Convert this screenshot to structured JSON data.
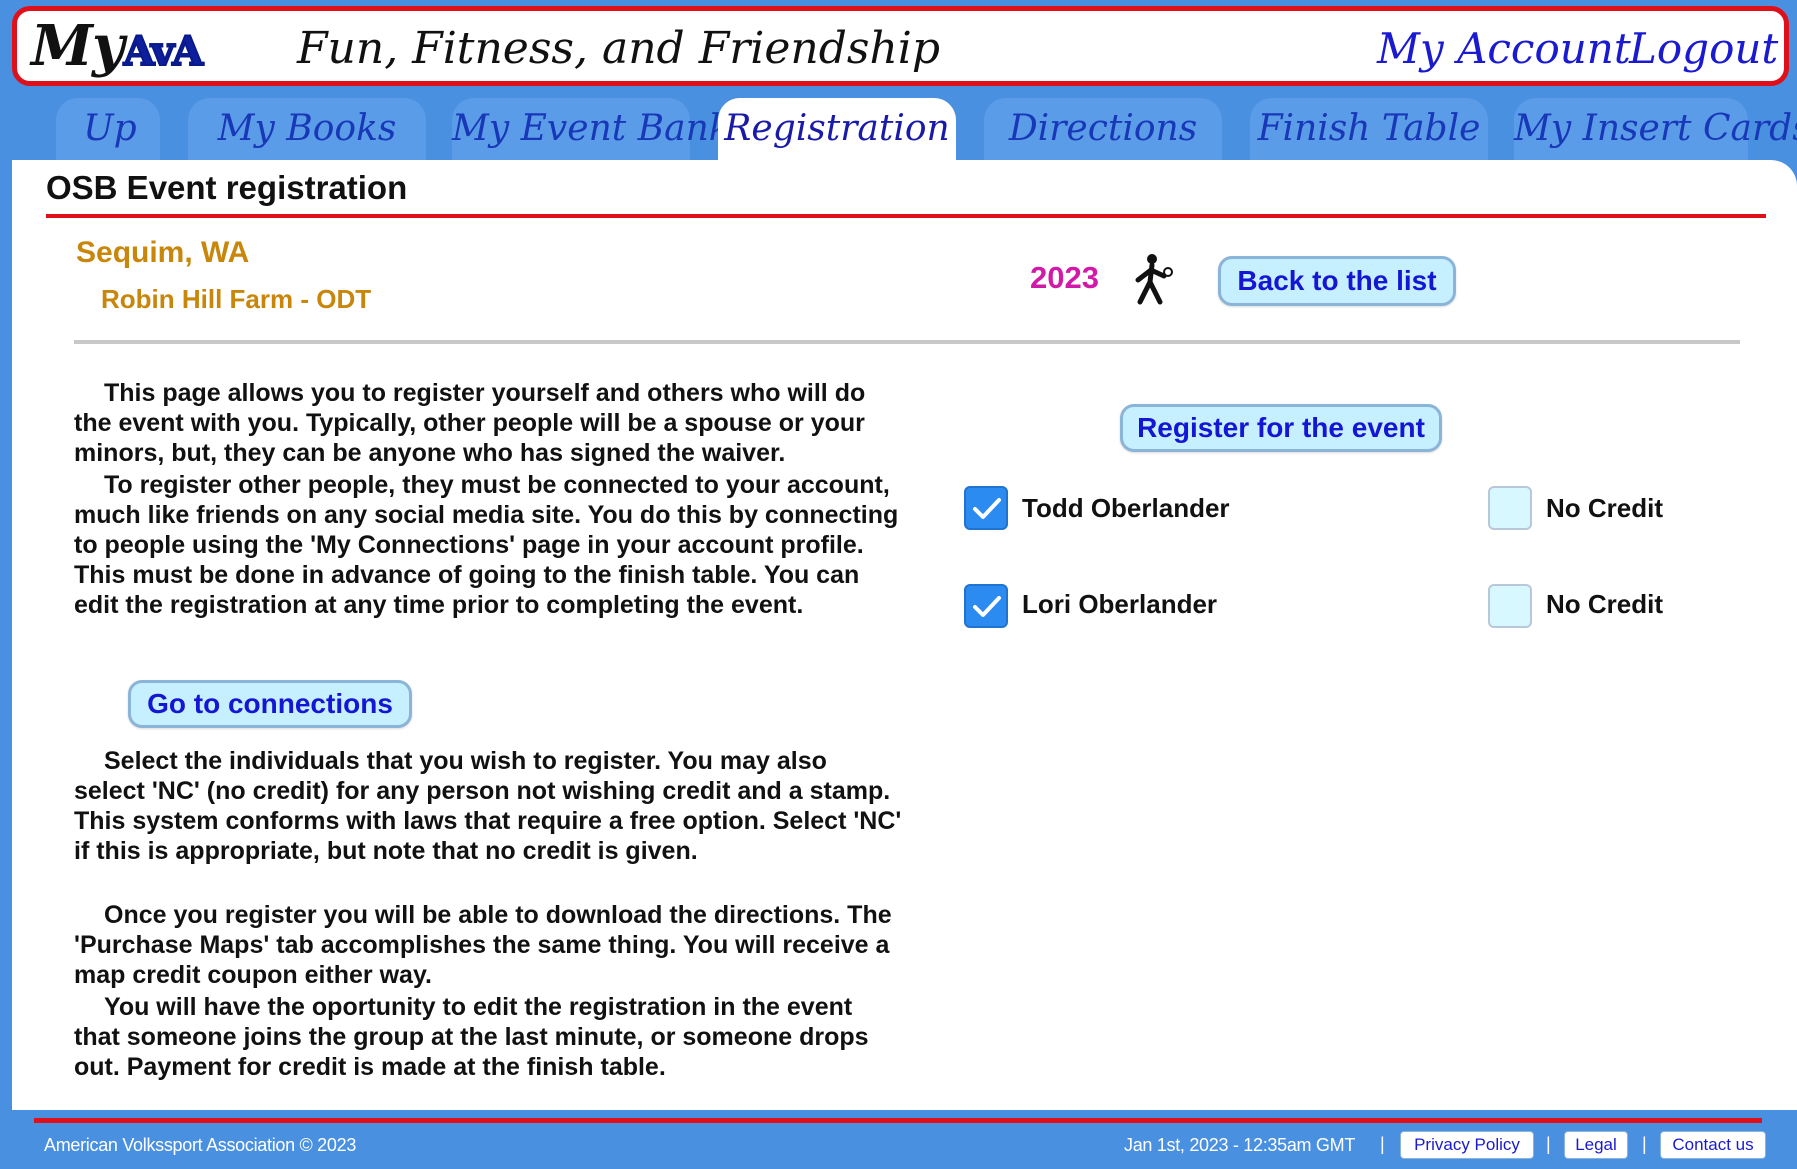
{
  "header": {
    "logo_my": "My",
    "logo_ava": "AvA",
    "tagline": "Fun, Fitness, and Friendship",
    "my_account": "My Account",
    "logout": "Logout"
  },
  "tabs": [
    {
      "label": "Up",
      "active": false
    },
    {
      "label": "My Books",
      "active": false
    },
    {
      "label": "My Event Bank",
      "active": false
    },
    {
      "label": "Registration",
      "active": true
    },
    {
      "label": "Directions",
      "active": false
    },
    {
      "label": "Finish Table",
      "active": false
    },
    {
      "label": "My Insert Cards",
      "active": false
    }
  ],
  "page": {
    "title": "OSB Event registration",
    "city": "Sequim, WA",
    "venue": "Robin Hill Farm - ODT",
    "year": "2023",
    "back_button": "Back to the list",
    "paragraphs": [
      "This page allows you to register yourself and others who will do the event with you. Typically, other people will be a spouse or your minors, but, they can be anyone who has signed the waiver.",
      "To register other people, they must be connected to your account, much like friends on any social media site. You do this by connecting to people using the 'My Connections' page in your account profile. This must be done in advance of going to the finish table. You can edit the registration at any time prior to completing the event.",
      "Select the individuals that you wish to register. You may also select 'NC' (no credit) for any person not wishing credit and a stamp. This system conforms with laws that require a free option. Select 'NC' if this is appropriate, but note that no credit is given.",
      "Once you register you will be able to download the directions. The 'Purchase Maps' tab accomplishes the same thing. You will receive a map credit coupon either way.",
      "You will have the oportunity to edit the registration in the event that someone joins the group at the last minute, or someone drops out. Payment for credit is made at the finish table."
    ],
    "connections_button": "Go to connections",
    "register_button": "Register for the event",
    "people": [
      {
        "name": "Todd Oberlander",
        "selected": true,
        "no_credit": false,
        "no_credit_label": "No Credit"
      },
      {
        "name": "Lori Oberlander",
        "selected": true,
        "no_credit": false,
        "no_credit_label": "No Credit"
      }
    ]
  },
  "footer": {
    "copyright": "American Volkssport Association © 2023",
    "date": "Jan 1st, 2023 - 12:35am GMT",
    "separator": "|",
    "privacy": "Privacy Policy",
    "legal": "Legal",
    "contact": "Contact us"
  },
  "colors": {
    "accent_red": "#e0101a",
    "tab_blue": "#5b9ce8",
    "background_blue": "#4a90e0",
    "link_blue": "#1a1ad0",
    "venue_gold": "#c8860a",
    "year_magenta": "#d21aa8",
    "checkbox_blue": "#2b8bf0"
  },
  "icons": {
    "up_tab": "up-arrow-icon",
    "event": "walker-icon",
    "checkbox": "check-icon"
  }
}
